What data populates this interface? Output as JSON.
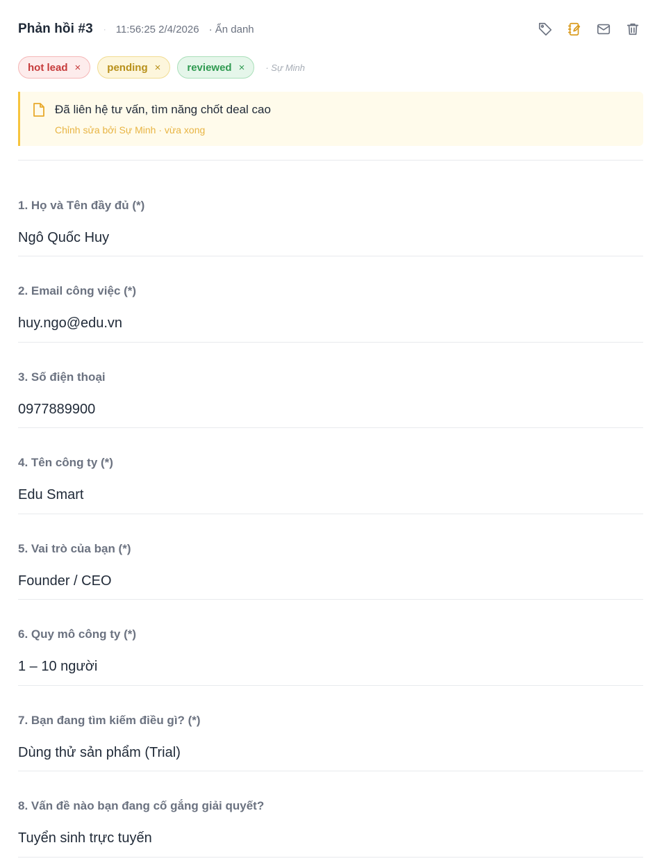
{
  "header": {
    "title": "Phản hồi #3",
    "separator": "·",
    "timestamp": "11:56:25 2/4/2026",
    "anonymous": "· Ẩn danh",
    "actions": [
      {
        "name": "tag-icon",
        "color": "#6b7280"
      },
      {
        "name": "edit-note-icon",
        "color": "#d99a1c"
      },
      {
        "name": "mail-icon",
        "color": "#6b7280"
      },
      {
        "name": "trash-icon",
        "color": "#6b7280"
      }
    ]
  },
  "tags": {
    "items": [
      {
        "label": "hot lead",
        "remove": "×"
      },
      {
        "label": "pending",
        "remove": "×"
      },
      {
        "label": "reviewed",
        "remove": "×"
      }
    ],
    "author": "· Sự Minh"
  },
  "note": {
    "icon": "note-icon",
    "text": "Đã liên hệ tư vấn, tìm năng chốt deal cao",
    "meta": "Chỉnh sửa bởi Sự Minh · vừa xong",
    "accent": "#f6c43d"
  },
  "fields": [
    {
      "label": "1. Họ và Tên đầy đủ (*)",
      "value": "Ngô Quốc Huy"
    },
    {
      "label": "2. Email công việc (*)",
      "value": "huy.ngo@edu.vn"
    },
    {
      "label": "3. Số điện thoại",
      "value": "0977889900"
    },
    {
      "label": "4. Tên công ty (*)",
      "value": "Edu Smart"
    },
    {
      "label": "5. Vai trò của bạn (*)",
      "value": "Founder / CEO"
    },
    {
      "label": "6. Quy mô công ty (*)",
      "value": "1 – 10 người"
    },
    {
      "label": "7. Bạn đang tìm kiếm điều gì? (*)",
      "value": "Dùng thử sản phẩm (Trial)"
    },
    {
      "label": "8. Vấn đề nào bạn đang cố gắng giải quyết?",
      "value": "Tuyển sinh trực tuyến"
    }
  ]
}
